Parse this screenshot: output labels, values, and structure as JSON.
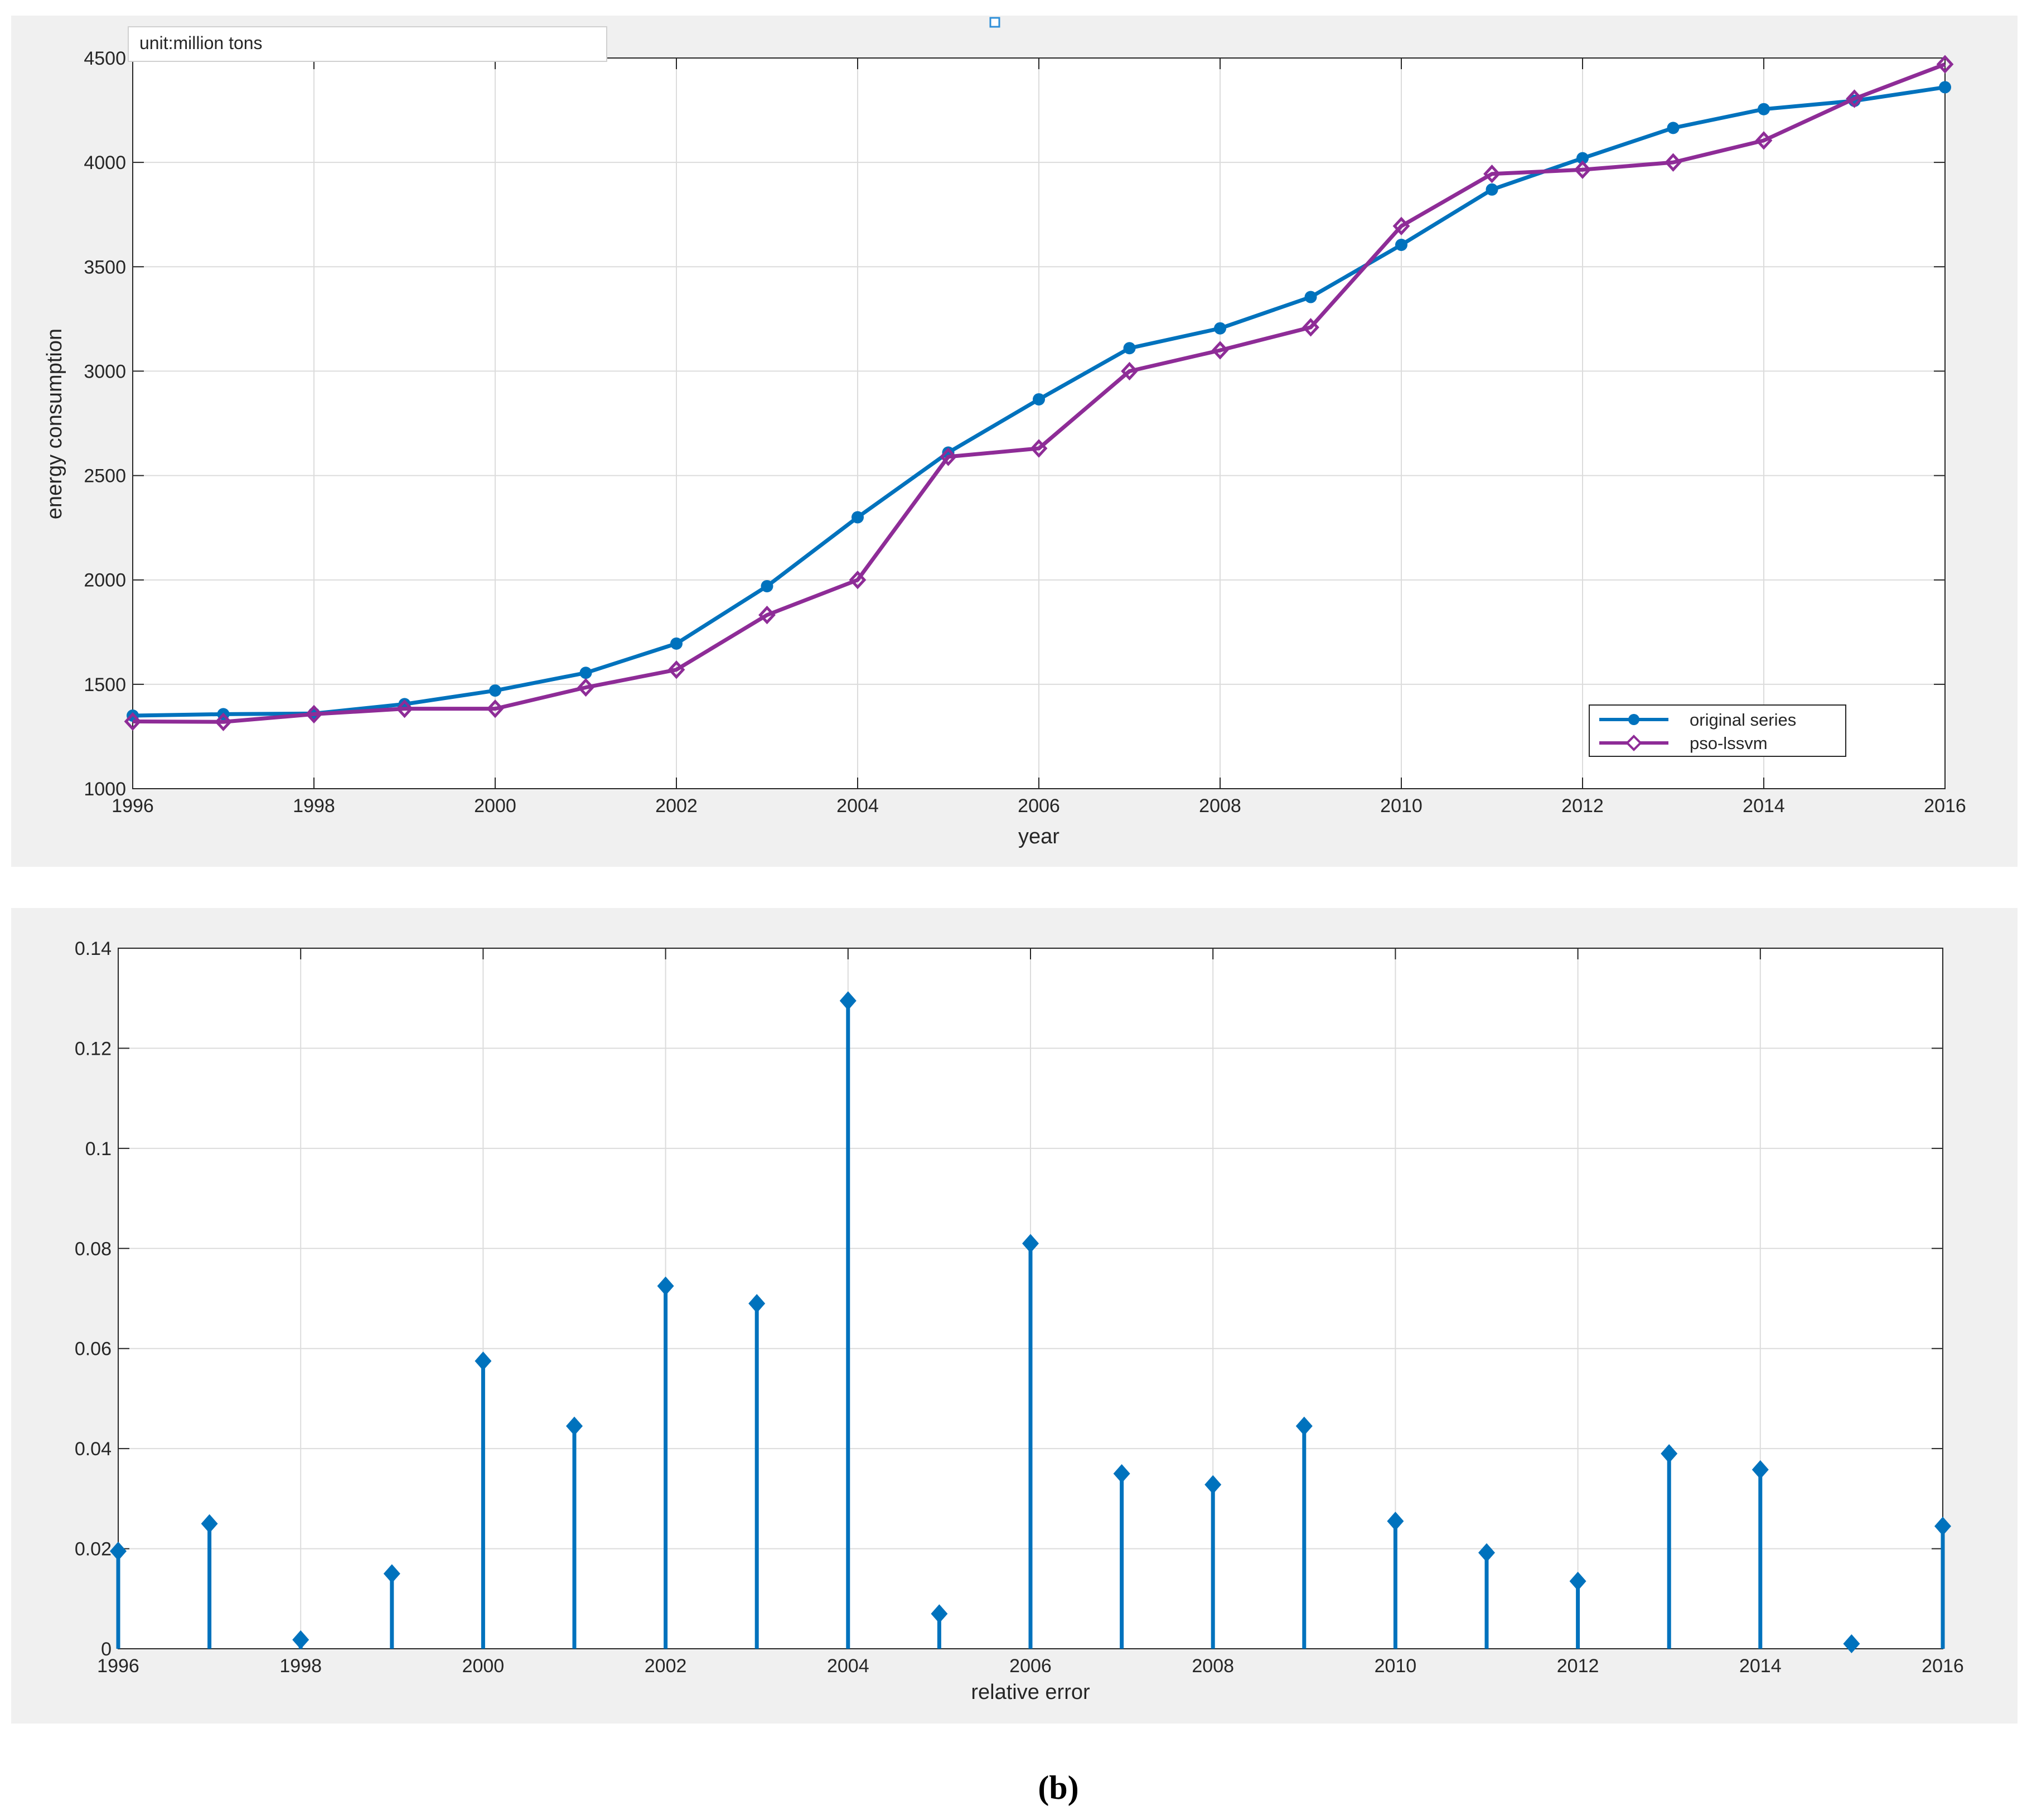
{
  "caption": "(b)",
  "chart_data": [
    {
      "type": "line",
      "xlabel": "year",
      "ylabel": "energy consumption",
      "annotation": "unit:million tons",
      "x": [
        1996,
        1997,
        1998,
        1999,
        2000,
        2001,
        2002,
        2003,
        2004,
        2005,
        2006,
        2007,
        2008,
        2009,
        2010,
        2011,
        2012,
        2013,
        2014,
        2015,
        2016
      ],
      "xlim": [
        1996,
        2016
      ],
      "ylim": [
        1000,
        4500
      ],
      "xticks": [
        "1996",
        "1998",
        "2000",
        "2002",
        "2004",
        "2006",
        "2008",
        "2010",
        "2012",
        "2014",
        "2016"
      ],
      "yticks": [
        "1000",
        "1500",
        "2000",
        "2500",
        "3000",
        "3500",
        "4000",
        "4500"
      ],
      "legend_position": "bottom-right",
      "series": [
        {
          "name": "original series",
          "color": "#0072BD",
          "marker": "circle",
          "values": [
            1350,
            1357,
            1360,
            1405,
            1470,
            1555,
            1695,
            1970,
            2300,
            2610,
            2865,
            3110,
            3205,
            3355,
            3605,
            3870,
            4020,
            4165,
            4255,
            4295,
            4360
          ]
        },
        {
          "name": "pso-lssvm",
          "color": "#8E2C97",
          "marker": "diamond",
          "values": [
            1322,
            1320,
            1357,
            1383,
            1383,
            1485,
            1570,
            1832,
            2000,
            2590,
            2630,
            3000,
            3100,
            3210,
            3695,
            3945,
            3965,
            4000,
            4105,
            4305,
            4470
          ]
        }
      ]
    },
    {
      "type": "stem",
      "xlabel": "relative error",
      "x": [
        1996,
        1997,
        1998,
        1999,
        2000,
        2001,
        2002,
        2003,
        2004,
        2005,
        2006,
        2007,
        2008,
        2009,
        2010,
        2011,
        2012,
        2013,
        2014,
        2015,
        2016
      ],
      "xlim": [
        1996,
        2016
      ],
      "ylim": [
        0,
        0.14
      ],
      "xticks": [
        "1996",
        "1998",
        "2000",
        "2002",
        "2004",
        "2006",
        "2008",
        "2010",
        "2012",
        "2014",
        "2016"
      ],
      "yticks": [
        "0",
        "0.02",
        "0.04",
        "0.06",
        "0.08",
        "0.1",
        "0.12",
        "0.14"
      ],
      "series": [
        {
          "color": "#0072BD",
          "marker": "diamond",
          "values": [
            0.0195,
            0.025,
            0.0018,
            0.015,
            0.0575,
            0.0445,
            0.0725,
            0.069,
            0.1295,
            0.007,
            0.081,
            0.035,
            0.0328,
            0.0445,
            0.0255,
            0.0192,
            0.0135,
            0.039,
            0.0358,
            0.001,
            0.0245
          ]
        }
      ]
    }
  ]
}
